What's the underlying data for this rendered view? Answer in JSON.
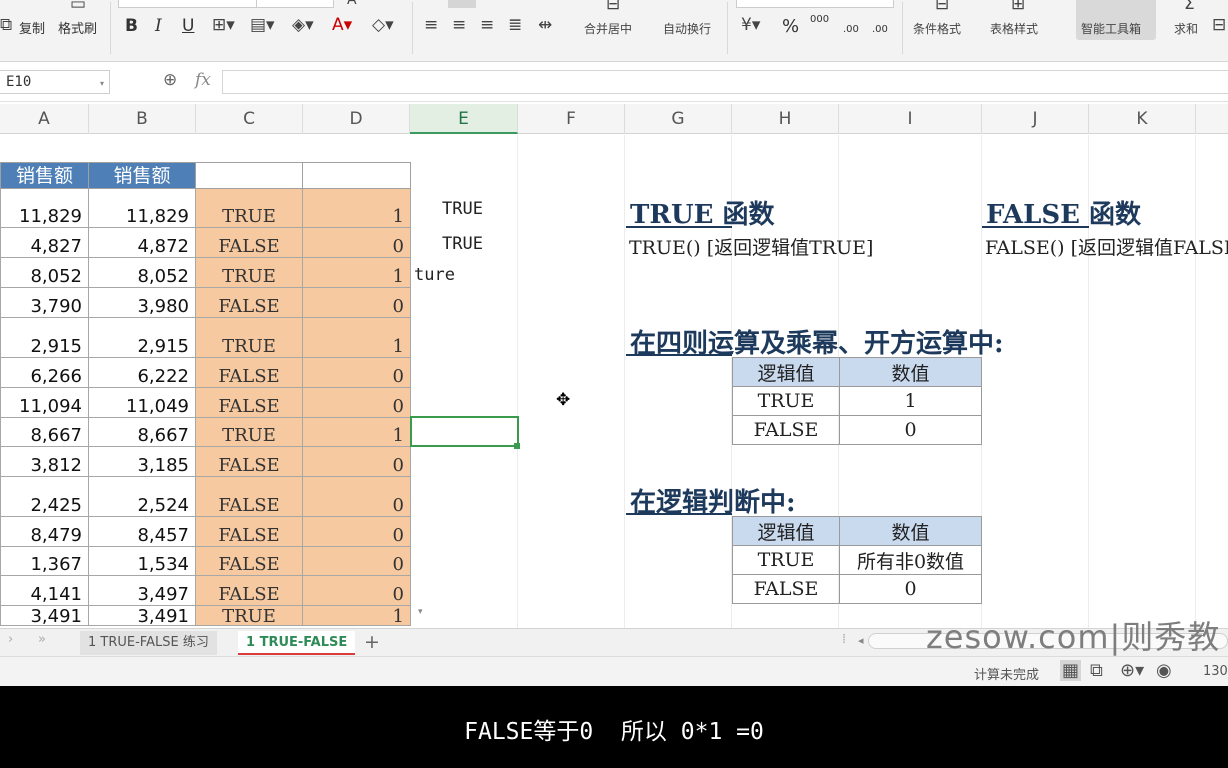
{
  "ribbon": {
    "copy_label": "复制",
    "format_painter_label": "格式刷",
    "bold_label": "B",
    "italic_label": "I",
    "underline_label": "U",
    "merge_center_label": "合并居中",
    "wrap_text_label": "自动换行",
    "percent_label": "%",
    "thousands_label": "000",
    "inc_decimal_label": ".00",
    "dec_decimal_label": ".00",
    "conditional_format_label": "条件格式",
    "table_style_label": "表格样式",
    "smart_toolbox_label": "智能工具箱",
    "sum_label": "求和"
  },
  "formula_bar": {
    "name_box": "E10",
    "fx_label": "fx",
    "formula": ""
  },
  "columns": [
    "A",
    "B",
    "C",
    "D",
    "E",
    "F",
    "G",
    "H",
    "I",
    "J",
    "K"
  ],
  "table": {
    "headers": [
      "销售额",
      "销售额"
    ],
    "rows": [
      {
        "a": "11,829",
        "b": "11,829",
        "c": "TRUE",
        "d": "1"
      },
      {
        "a": "4,827",
        "b": "4,872",
        "c": "FALSE",
        "d": "0"
      },
      {
        "a": "8,052",
        "b": "8,052",
        "c": "TRUE",
        "d": "1"
      },
      {
        "a": "3,790",
        "b": "3,980",
        "c": "FALSE",
        "d": "0"
      },
      {
        "a": "2,915",
        "b": "2,915",
        "c": "TRUE",
        "d": "1"
      },
      {
        "a": "6,266",
        "b": "6,222",
        "c": "FALSE",
        "d": "0"
      },
      {
        "a": "11,094",
        "b": "11,049",
        "c": "FALSE",
        "d": "0"
      },
      {
        "a": "8,667",
        "b": "8,667",
        "c": "TRUE",
        "d": "1"
      },
      {
        "a": "3,812",
        "b": "3,185",
        "c": "FALSE",
        "d": "0"
      },
      {
        "a": "2,425",
        "b": "2,524",
        "c": "FALSE",
        "d": "0"
      },
      {
        "a": "8,479",
        "b": "8,457",
        "c": "FALSE",
        "d": "0"
      },
      {
        "a": "1,367",
        "b": "1,534",
        "c": "FALSE",
        "d": "0"
      },
      {
        "a": "4,141",
        "b": "3,497",
        "c": "FALSE",
        "d": "0"
      },
      {
        "a": "3,491",
        "b": "3,491",
        "c": "TRUE",
        "d": "1"
      }
    ]
  },
  "e_cells": [
    "TRUE",
    "TRUE",
    "ture"
  ],
  "panel": {
    "true_title": "TRUE 函数",
    "true_syntax": "TRUE()    [返回逻辑值TRUE]",
    "false_title": "FALSE 函数",
    "false_syntax": "FALSE()   [返回逻辑值FALSE]",
    "arith_title": "在四则运算及乘幂、开方运算中:",
    "arith_table": {
      "headers": [
        "逻辑值",
        "数值"
      ],
      "rows": [
        [
          "TRUE",
          "1"
        ],
        [
          "FALSE",
          "0"
        ]
      ]
    },
    "logic_title": "在逻辑判断中:",
    "logic_table": {
      "headers": [
        "逻辑值",
        "数值"
      ],
      "rows": [
        [
          "TRUE",
          "所有非0数值"
        ],
        [
          "FALSE",
          "0"
        ]
      ]
    }
  },
  "sheet_tabs": [
    "1 TRUE-FALSE 练习",
    "1 TRUE-FALSE"
  ],
  "watermark": "zesow.com|则秀教",
  "status": {
    "calc_text": "计算未完成",
    "zoom": "130"
  },
  "subtitle": "FALSE等于0  所以 0*1 =0",
  "colors": {
    "header_blue": "#4e7fb6",
    "orange_fill": "#f7c9a0",
    "panel_header": "#c9d9ee",
    "title_navy": "#1d3a5c",
    "selection_green": "#3a9b4c"
  }
}
